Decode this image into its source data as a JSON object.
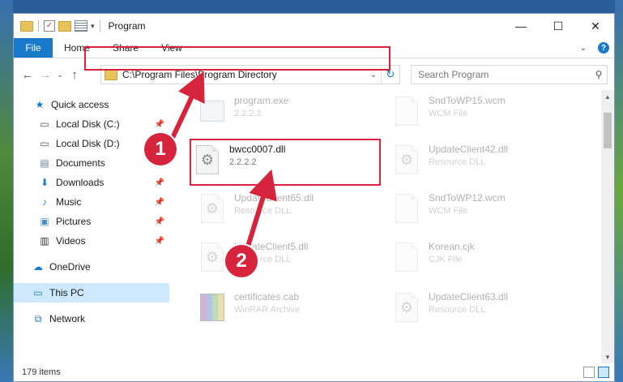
{
  "window": {
    "title": "Program",
    "controls": {
      "minimize": "—",
      "maximize": "☐",
      "close": "✕"
    }
  },
  "ribbon": {
    "tabs": [
      "File",
      "Home",
      "Share",
      "View"
    ]
  },
  "address": {
    "path": "C:\\Program Files\\Program Directory"
  },
  "search": {
    "placeholder": "Search Program"
  },
  "sidebar": {
    "items": [
      {
        "label": "Quick access",
        "icon": "star-icon",
        "pinned": false
      },
      {
        "label": "Local Disk (C:)",
        "icon": "drive-icon",
        "pinned": true
      },
      {
        "label": "Local Disk (D:)",
        "icon": "drive-icon",
        "pinned": true
      },
      {
        "label": "Documents",
        "icon": "documents-icon",
        "pinned": true
      },
      {
        "label": "Downloads",
        "icon": "downloads-icon",
        "pinned": true
      },
      {
        "label": "Music",
        "icon": "music-icon",
        "pinned": true
      },
      {
        "label": "Pictures",
        "icon": "pictures-icon",
        "pinned": true
      },
      {
        "label": "Videos",
        "icon": "videos-icon",
        "pinned": true
      },
      {
        "label": "OneDrive",
        "icon": "cloud-icon",
        "pinned": false
      },
      {
        "label": "This PC",
        "icon": "computer-icon",
        "pinned": false
      },
      {
        "label": "Network",
        "icon": "network-icon",
        "pinned": false
      }
    ],
    "pin_glyph": "📌"
  },
  "files": [
    {
      "name": "program.exe",
      "meta": "2.2.2.2",
      "kind": "exe"
    },
    {
      "name": "SndToWP15.wcm",
      "meta": "WCM File",
      "kind": "doc"
    },
    {
      "name": "bwcc0007.dll",
      "meta": "2.2.2.2",
      "kind": "dll"
    },
    {
      "name": "UpdateClient42.dll",
      "meta": "Resource DLL",
      "kind": "dll"
    },
    {
      "name": "UpdateClient65.dll",
      "meta": "Resource DLL",
      "kind": "dll"
    },
    {
      "name": "SndToWP12.wcm",
      "meta": "WCM File",
      "kind": "doc"
    },
    {
      "name": "UpdateClient5.dll",
      "meta": "Resource DLL",
      "kind": "dll"
    },
    {
      "name": "Korean.cjk",
      "meta": "CJK File",
      "kind": "doc"
    },
    {
      "name": "certificates.cab",
      "meta": "WinRAR Archive",
      "kind": "rar"
    },
    {
      "name": "UpdateClient63.dll",
      "meta": "Resource DLL",
      "kind": "dll"
    }
  ],
  "status": {
    "items": "179 items"
  },
  "badges": {
    "one": "1",
    "two": "2"
  },
  "colors": {
    "accent": "#1979ca",
    "highlight": "#d6243c"
  }
}
